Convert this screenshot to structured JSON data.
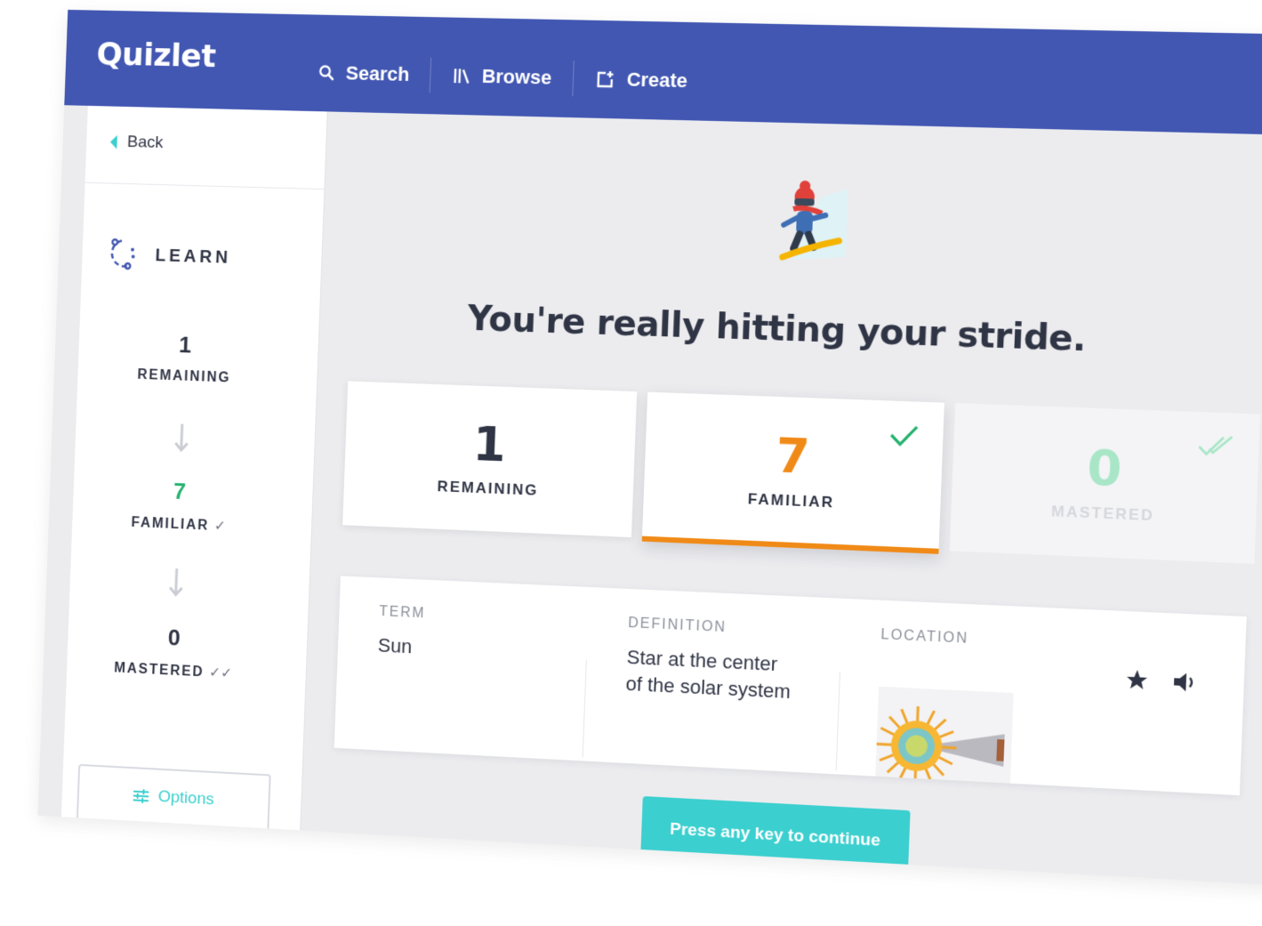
{
  "header": {
    "logo": "Quizlet",
    "nav": [
      {
        "label": "Search",
        "icon": "search-icon"
      },
      {
        "label": "Browse",
        "icon": "library-icon"
      },
      {
        "label": "Create",
        "icon": "create-icon"
      }
    ],
    "color": "#4257b2"
  },
  "sidebar": {
    "back_label": "Back",
    "mode_label": "LEARN",
    "remaining": {
      "value": "1",
      "label": "REMAINING"
    },
    "familiar": {
      "value": "7",
      "label": "FAMILIAR",
      "mark": "✓"
    },
    "mastered": {
      "value": "0",
      "label": "MASTERED",
      "mark": "✓✓"
    },
    "options_label": "Options"
  },
  "main": {
    "headline": "You're really hitting your stride.",
    "cards": [
      {
        "value": "1",
        "label": "REMAINING"
      },
      {
        "value": "7",
        "label": "FAMILIAR"
      },
      {
        "value": "0",
        "label": "MASTERED"
      }
    ],
    "term": {
      "term_head": "TERM",
      "term_value": "Sun",
      "definition_head": "DEFINITION",
      "definition_line1": "Star at the center",
      "definition_line2": "of the solar system",
      "location_head": "LOCATION"
    },
    "continue_label": "Press any key to continue"
  },
  "colors": {
    "accent": "#3ccfcf",
    "familiar": "#f08a17",
    "mastered": "#a9e6c8",
    "familiar_green": "#23b26d"
  }
}
